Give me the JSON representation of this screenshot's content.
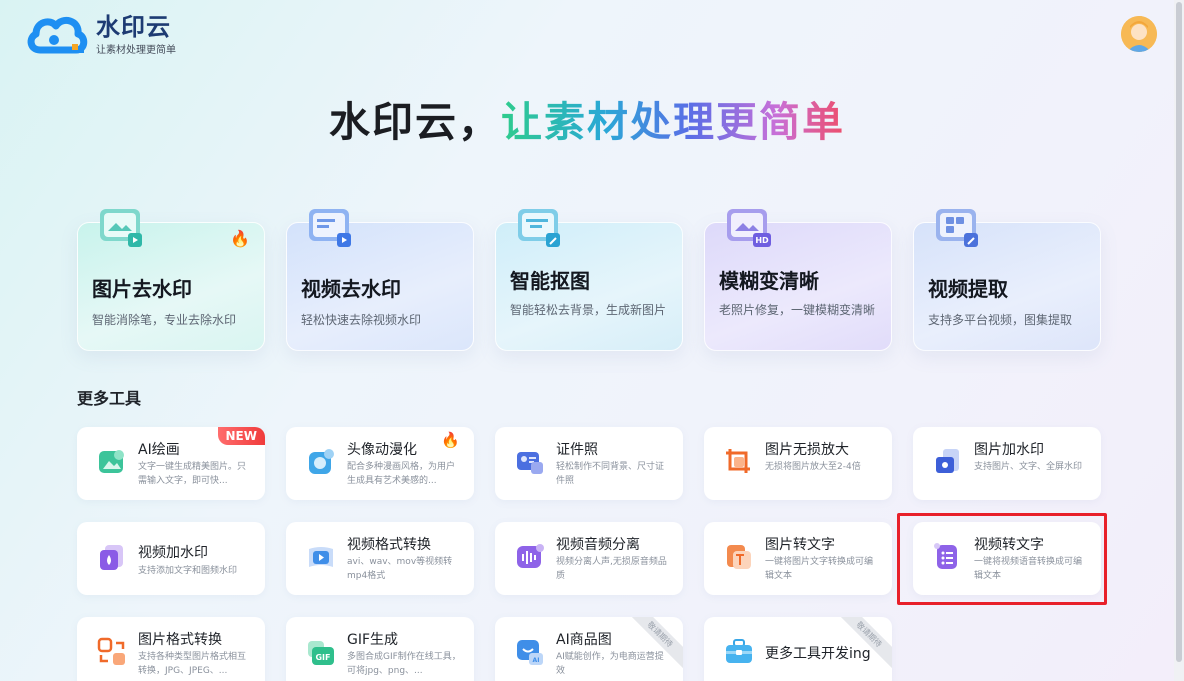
{
  "logo": {
    "title": "水印云",
    "subtitle": "让素材处理更简单"
  },
  "hero": {
    "part1": "水印云，",
    "part2": "让素材处理更简单"
  },
  "features": [
    {
      "title": "图片去水印",
      "desc": "智能消除笔，专业去除水印",
      "icon": "image-icon",
      "hot": true
    },
    {
      "title": "视频去水印",
      "desc": "轻松快速去除视频水印",
      "icon": "video-icon",
      "hot": false
    },
    {
      "title": "智能抠图",
      "desc": "智能轻松去背景，生成新图片",
      "icon": "cutout-icon",
      "hot": false
    },
    {
      "title": "模糊变清晰",
      "desc": "老照片修复，一键模糊变清晰",
      "icon": "hd-icon",
      "hot": false
    },
    {
      "title": "视频提取",
      "desc": "支持多平台视频，图集提取",
      "icon": "extract-icon",
      "hot": false
    }
  ],
  "more_tools_title": "更多工具",
  "tools": [
    {
      "name": "AI绘画",
      "desc": "文字一键生成精美图片。只需输入文字，即可快...",
      "badge": "NEW",
      "icon": "ai-paint-icon"
    },
    {
      "name": "头像动漫化",
      "desc": "配合多种漫画风格，为用户生成具有艺术美感的...",
      "badge": "fire",
      "icon": "anime-icon"
    },
    {
      "name": "证件照",
      "desc": "轻松制作不同背景、尺寸证件照",
      "icon": "id-photo-icon"
    },
    {
      "name": "图片无损放大",
      "desc": "无损将图片放大至2-4倍",
      "icon": "enlarge-icon"
    },
    {
      "name": "图片加水印",
      "desc": "支持图片、文字、全屏水印",
      "icon": "add-watermark-icon"
    },
    {
      "name": "视频加水印",
      "desc": "支持添加文字和图频水印",
      "icon": "video-watermark-icon"
    },
    {
      "name": "视频格式转换",
      "desc": "avi、wav、mov等视频转mp4格式",
      "icon": "video-convert-icon"
    },
    {
      "name": "视频音频分离",
      "desc": "视频分离人声,无损原音频品质",
      "icon": "audio-split-icon"
    },
    {
      "name": "图片转文字",
      "desc": "一键将图片文字转换成可编辑文本",
      "icon": "ocr-icon"
    },
    {
      "name": "视频转文字",
      "desc": "一键将视频语音转换成可编辑文本",
      "icon": "video-text-icon"
    },
    {
      "name": "图片格式转换",
      "desc": "支持各种类型图片格式相互转换，JPG、JPEG、...",
      "icon": "img-convert-icon"
    },
    {
      "name": "GIF生成",
      "desc": "多图合成GIF制作在线工具，可将jpg、png、...",
      "icon": "gif-icon"
    },
    {
      "name": "AI商品图",
      "desc": "AI赋能创作，为电商运营提效",
      "ribbon": "敬请期待",
      "icon": "ai-product-icon"
    },
    {
      "name": "更多工具开发ing",
      "desc": "",
      "ribbon": "敬请期待",
      "icon": "toolbox-icon"
    }
  ],
  "colors": {
    "accent": "#1d3b73",
    "highlight": "#e8202a"
  }
}
